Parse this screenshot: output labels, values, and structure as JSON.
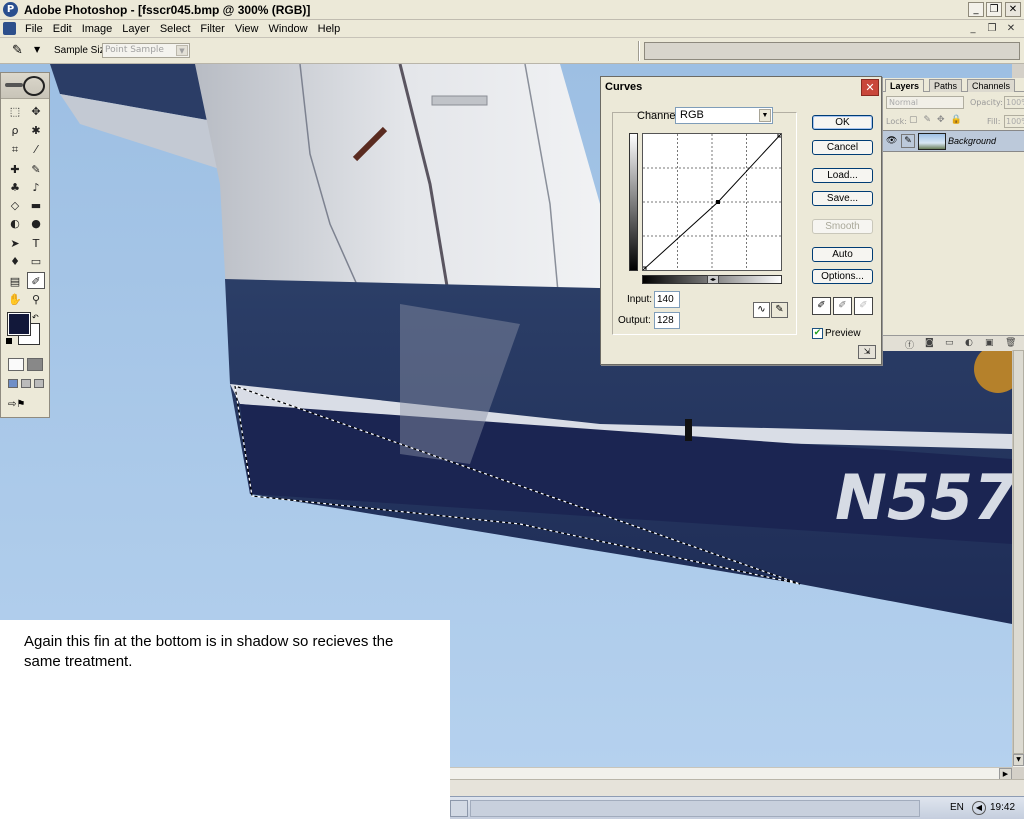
{
  "window": {
    "title": "Adobe Photoshop - [fsscr045.bmp @ 300% (RGB)]",
    "app_icon": "photoshop-icon",
    "minimize": "_",
    "restore": "❐",
    "close": "✕"
  },
  "menu": {
    "items": [
      "File",
      "Edit",
      "Image",
      "Layer",
      "Select",
      "Filter",
      "View",
      "Window",
      "Help"
    ],
    "doc_minimize": "_",
    "doc_restore": "❐",
    "doc_close": "✕"
  },
  "options_bar": {
    "tool_icon": "eyedropper-icon",
    "sample_size_label": "Sample Size:",
    "sample_size_value": "Point Sample"
  },
  "canvas": {
    "registration_text": "N557"
  },
  "curves": {
    "title": "Curves",
    "channel_label": "Channel:",
    "channel_value": "RGB",
    "input_label": "Input:",
    "input_value": "140",
    "output_label": "Output:",
    "output_value": "128",
    "buttons": {
      "ok": "OK",
      "cancel": "Cancel",
      "load": "Load...",
      "save": "Save...",
      "smooth": "Smooth",
      "auto": "Auto",
      "options": "Options..."
    },
    "preview_label": "Preview",
    "preview_checked": true
  },
  "layers": {
    "tabs": [
      "Layers",
      "Paths",
      "Channels"
    ],
    "blend_mode": "Normal",
    "opacity_label": "Opacity:",
    "opacity_value": "100%",
    "lock_label": "Lock:",
    "fill_label": "Fill:",
    "fill_value": "100%",
    "layer_name": "Background"
  },
  "taskbar": {
    "language": "EN",
    "clock": "19:42"
  },
  "caption": {
    "text": "Again this fin at the bottom is in shadow so recieves the same treatment."
  }
}
